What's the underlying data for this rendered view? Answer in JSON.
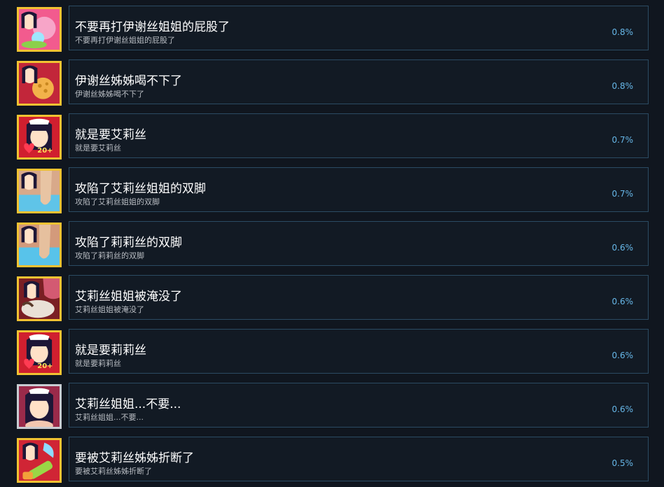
{
  "achievements": [
    {
      "title": "不要再打伊谢丝姐姐的屁股了",
      "description": "不要再打伊谢丝姐姐的屁股了",
      "percent": "0.8%",
      "icon": "girl-splash-achievement-icon"
    },
    {
      "title": "伊谢丝姊姊喝不下了",
      "description": "伊谢丝姊姊喝不下了",
      "percent": "0.8%",
      "icon": "girl-sponge-achievement-icon"
    },
    {
      "title": "就是要艾莉丝",
      "description": "就是要艾莉丝",
      "percent": "0.7%",
      "icon": "maid-heart-achievement-icon",
      "badge": "20+"
    },
    {
      "title": "攻陷了艾莉丝姐姐的双脚",
      "description": "攻陷了艾莉丝姐姐的双脚",
      "percent": "0.7%",
      "icon": "girl-feet-achievement-icon"
    },
    {
      "title": "攻陷了莉莉丝的双脚",
      "description": "攻陷了莉莉丝的双脚",
      "percent": "0.6%",
      "icon": "girl-feet-achievement-icon"
    },
    {
      "title": "艾莉丝姐姐被淹没了",
      "description": "艾莉丝姐姐被淹没了",
      "percent": "0.6%",
      "icon": "girl-flood-achievement-icon"
    },
    {
      "title": "就是要莉莉丝",
      "description": "就是要莉莉丝",
      "percent": "0.6%",
      "icon": "maid-heart-achievement-icon",
      "badge": "20+"
    },
    {
      "title": "艾莉丝姐姐...不要...",
      "description": "艾莉丝姐姐...不要...",
      "percent": "0.6%",
      "icon": "maid-portrait-achievement-icon"
    },
    {
      "title": "要被艾莉丝姊姊折断了",
      "description": "要被艾莉丝姊姊折断了",
      "percent": "0.5%",
      "icon": "girl-watergun-achievement-icon"
    }
  ]
}
